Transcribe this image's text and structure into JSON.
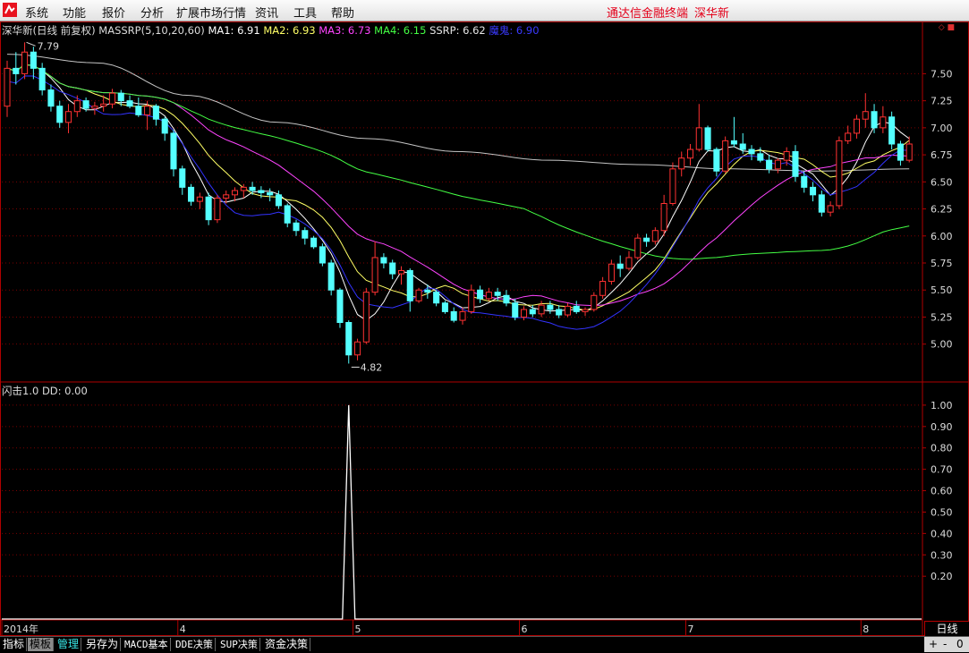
{
  "menu": {
    "items": [
      "系统",
      "功能",
      "报价",
      "分析",
      "扩展市场行情",
      "资讯",
      "工具",
      "帮助"
    ],
    "right_title": "通达信金融终端",
    "right_stock": "深华新"
  },
  "legend": {
    "name": "深华新(日线 前复权)",
    "indicator": "MASSRP(5,10,20,60)",
    "ma1": "MA1: 6.91",
    "ma2": "MA2: 6.93",
    "ma3": "MA3: 6.73",
    "ma4": "MA4: 6.15",
    "ssrp": "SSRP: 6.62",
    "ghost": "魔鬼: 6.90",
    "colors": {
      "ma1": "#ffffff",
      "ma2": "#ffff66",
      "ma3": "#ff44ff",
      "ma4": "#44ff44",
      "ssrp": "#e6e6e6",
      "ghost": "#3333ff"
    }
  },
  "sub_legend": "闪击1.0 DD: 0.00",
  "window_controls": "◇ ■",
  "annotations": {
    "high": "7.79",
    "low": "4.82"
  },
  "price_axis_ticks": [
    "7.50",
    "7.25",
    "7.00",
    "6.75",
    "6.50",
    "6.25",
    "6.00",
    "5.75",
    "5.50",
    "5.25",
    "5.00"
  ],
  "sub_axis_ticks": [
    "1.00",
    "0.90",
    "0.80",
    "0.70",
    "0.60",
    "0.50",
    "0.40",
    "0.30",
    "0.20"
  ],
  "x_axis_labels": [
    "2014年",
    "4",
    "5",
    "6",
    "7",
    "8"
  ],
  "period": "日线",
  "bottom_tabs": [
    "指标",
    "模板",
    "管理",
    "另存为",
    "MACD基本",
    "DDE决策",
    "SUP决策",
    "资金决策"
  ],
  "zoom": {
    "plus": "+",
    "minus": "-",
    "zero": "0"
  },
  "chart_data": {
    "type": "candlestick",
    "ylim": [
      4.65,
      7.95
    ],
    "up_color": "#ff3232",
    "down_color": "#54ffff",
    "candles": [
      [
        7.2,
        7.62,
        7.1,
        7.55
      ],
      [
        7.55,
        7.7,
        7.4,
        7.5
      ],
      [
        7.5,
        7.79,
        7.45,
        7.7
      ],
      [
        7.7,
        7.75,
        7.45,
        7.55
      ],
      [
        7.55,
        7.6,
        7.3,
        7.35
      ],
      [
        7.35,
        7.4,
        7.15,
        7.2
      ],
      [
        7.2,
        7.25,
        7.0,
        7.05
      ],
      [
        7.05,
        7.22,
        6.95,
        7.15
      ],
      [
        7.15,
        7.3,
        7.1,
        7.25
      ],
      [
        7.25,
        7.28,
        7.15,
        7.18
      ],
      [
        7.18,
        7.24,
        7.12,
        7.2
      ],
      [
        7.2,
        7.3,
        7.15,
        7.22
      ],
      [
        7.22,
        7.36,
        7.18,
        7.32
      ],
      [
        7.32,
        7.35,
        7.2,
        7.25
      ],
      [
        7.25,
        7.3,
        7.18,
        7.2
      ],
      [
        7.2,
        7.28,
        7.1,
        7.12
      ],
      [
        7.12,
        7.25,
        6.98,
        7.2
      ],
      [
        7.2,
        7.22,
        7.02,
        7.08
      ],
      [
        7.08,
        7.1,
        6.88,
        6.95
      ],
      [
        6.95,
        6.98,
        6.55,
        6.62
      ],
      [
        6.62,
        6.65,
        6.38,
        6.45
      ],
      [
        6.45,
        6.48,
        6.28,
        6.32
      ],
      [
        6.32,
        6.4,
        6.25,
        6.36
      ],
      [
        6.36,
        6.4,
        6.1,
        6.15
      ],
      [
        6.15,
        6.38,
        6.12,
        6.35
      ],
      [
        6.35,
        6.42,
        6.3,
        6.38
      ],
      [
        6.38,
        6.45,
        6.32,
        6.42
      ],
      [
        6.42,
        6.48,
        6.35,
        6.45
      ],
      [
        6.45,
        6.5,
        6.38,
        6.42
      ],
      [
        6.42,
        6.46,
        6.35,
        6.4
      ],
      [
        6.4,
        6.44,
        6.32,
        6.38
      ],
      [
        6.38,
        6.42,
        6.25,
        6.28
      ],
      [
        6.28,
        6.3,
        6.08,
        6.12
      ],
      [
        6.12,
        6.15,
        6.0,
        6.05
      ],
      [
        6.05,
        6.08,
        5.92,
        5.98
      ],
      [
        5.98,
        6.0,
        5.88,
        5.9
      ],
      [
        5.9,
        5.93,
        5.72,
        5.75
      ],
      [
        5.75,
        5.78,
        5.45,
        5.5
      ],
      [
        5.5,
        5.52,
        5.15,
        5.2
      ],
      [
        5.2,
        5.22,
        4.82,
        4.9
      ],
      [
        4.9,
        5.05,
        4.85,
        5.02
      ],
      [
        5.02,
        5.52,
        5.0,
        5.48
      ],
      [
        5.48,
        5.95,
        5.45,
        5.8
      ],
      [
        5.8,
        5.84,
        5.7,
        5.75
      ],
      [
        5.75,
        5.78,
        5.6,
        5.65
      ],
      [
        5.65,
        5.72,
        5.55,
        5.68
      ],
      [
        5.68,
        5.7,
        5.3,
        5.4
      ],
      [
        5.4,
        5.52,
        5.38,
        5.5
      ],
      [
        5.5,
        5.55,
        5.42,
        5.48
      ],
      [
        5.48,
        5.5,
        5.35,
        5.38
      ],
      [
        5.38,
        5.4,
        5.28,
        5.3
      ],
      [
        5.3,
        5.34,
        5.2,
        5.22
      ],
      [
        5.22,
        5.34,
        5.18,
        5.3
      ],
      [
        5.3,
        5.55,
        5.28,
        5.5
      ],
      [
        5.5,
        5.54,
        5.38,
        5.42
      ],
      [
        5.42,
        5.52,
        5.4,
        5.48
      ],
      [
        5.48,
        5.52,
        5.4,
        5.45
      ],
      [
        5.45,
        5.5,
        5.35,
        5.38
      ],
      [
        5.38,
        5.42,
        5.22,
        5.25
      ],
      [
        5.25,
        5.35,
        5.22,
        5.32
      ],
      [
        5.32,
        5.36,
        5.25,
        5.28
      ],
      [
        5.28,
        5.4,
        5.25,
        5.36
      ],
      [
        5.36,
        5.4,
        5.28,
        5.32
      ],
      [
        5.32,
        5.36,
        5.24,
        5.27
      ],
      [
        5.27,
        5.38,
        5.25,
        5.35
      ],
      [
        5.35,
        5.4,
        5.28,
        5.3
      ],
      [
        5.3,
        5.34,
        5.26,
        5.32
      ],
      [
        5.32,
        5.48,
        5.3,
        5.45
      ],
      [
        5.45,
        5.62,
        5.42,
        5.58
      ],
      [
        5.58,
        5.78,
        5.55,
        5.74
      ],
      [
        5.74,
        5.82,
        5.62,
        5.7
      ],
      [
        5.7,
        5.86,
        5.68,
        5.8
      ],
      [
        5.8,
        6.02,
        5.78,
        5.98
      ],
      [
        5.98,
        6.02,
        5.9,
        5.95
      ],
      [
        5.95,
        6.08,
        5.92,
        6.05
      ],
      [
        6.05,
        6.38,
        6.0,
        6.3
      ],
      [
        6.3,
        6.68,
        6.28,
        6.62
      ],
      [
        6.62,
        6.78,
        6.55,
        6.72
      ],
      [
        6.72,
        6.85,
        6.65,
        6.8
      ],
      [
        6.8,
        7.22,
        6.78,
        7.0
      ],
      [
        7.0,
        7.02,
        6.78,
        6.8
      ],
      [
        6.8,
        6.82,
        6.55,
        6.6
      ],
      [
        6.6,
        6.92,
        6.58,
        6.88
      ],
      [
        6.88,
        7.1,
        6.82,
        6.85
      ],
      [
        6.85,
        6.95,
        6.76,
        6.8
      ],
      [
        6.8,
        6.84,
        6.7,
        6.76
      ],
      [
        6.76,
        6.82,
        6.68,
        6.7
      ],
      [
        6.7,
        6.75,
        6.58,
        6.62
      ],
      [
        6.62,
        6.72,
        6.58,
        6.7
      ],
      [
        6.7,
        6.82,
        6.65,
        6.78
      ],
      [
        6.78,
        6.84,
        6.5,
        6.55
      ],
      [
        6.55,
        6.6,
        6.4,
        6.45
      ],
      [
        6.45,
        6.5,
        6.32,
        6.38
      ],
      [
        6.38,
        6.42,
        6.18,
        6.22
      ],
      [
        6.22,
        6.32,
        6.18,
        6.28
      ],
      [
        6.28,
        6.92,
        6.25,
        6.88
      ],
      [
        6.88,
        7.02,
        6.85,
        6.95
      ],
      [
        6.95,
        7.12,
        6.9,
        7.08
      ],
      [
        7.08,
        7.32,
        7.0,
        7.15
      ],
      [
        7.15,
        7.22,
        6.95,
        7.0
      ],
      [
        7.0,
        7.2,
        6.95,
        7.1
      ],
      [
        7.1,
        7.15,
        6.8,
        6.85
      ],
      [
        6.85,
        6.88,
        6.65,
        6.7
      ],
      [
        6.7,
        6.92,
        6.68,
        6.85
      ]
    ],
    "ma_series": [
      {
        "key": "ma1",
        "color": "#ffffff",
        "period": 5
      },
      {
        "key": "ma2",
        "color": "#ffff66",
        "period": 10
      },
      {
        "key": "ma3",
        "color": "#ff44ff",
        "period": 20
      },
      {
        "key": "ma4",
        "color": "#44ff44",
        "period": 60
      }
    ],
    "ghost_color": "#3333ff",
    "ssrp_color": "#e6e6e6",
    "ssrp_anchor": [
      7.68,
      7.6,
      7.3,
      7.05,
      6.9,
      6.78,
      6.7,
      6.66,
      6.62,
      6.6,
      6.62
    ],
    "month_starts": [
      0,
      20,
      40,
      59,
      78,
      98
    ],
    "sub_chart": {
      "ylim": [
        0,
        1.1
      ],
      "spike_index": 39,
      "spike_value": 1.0
    }
  }
}
